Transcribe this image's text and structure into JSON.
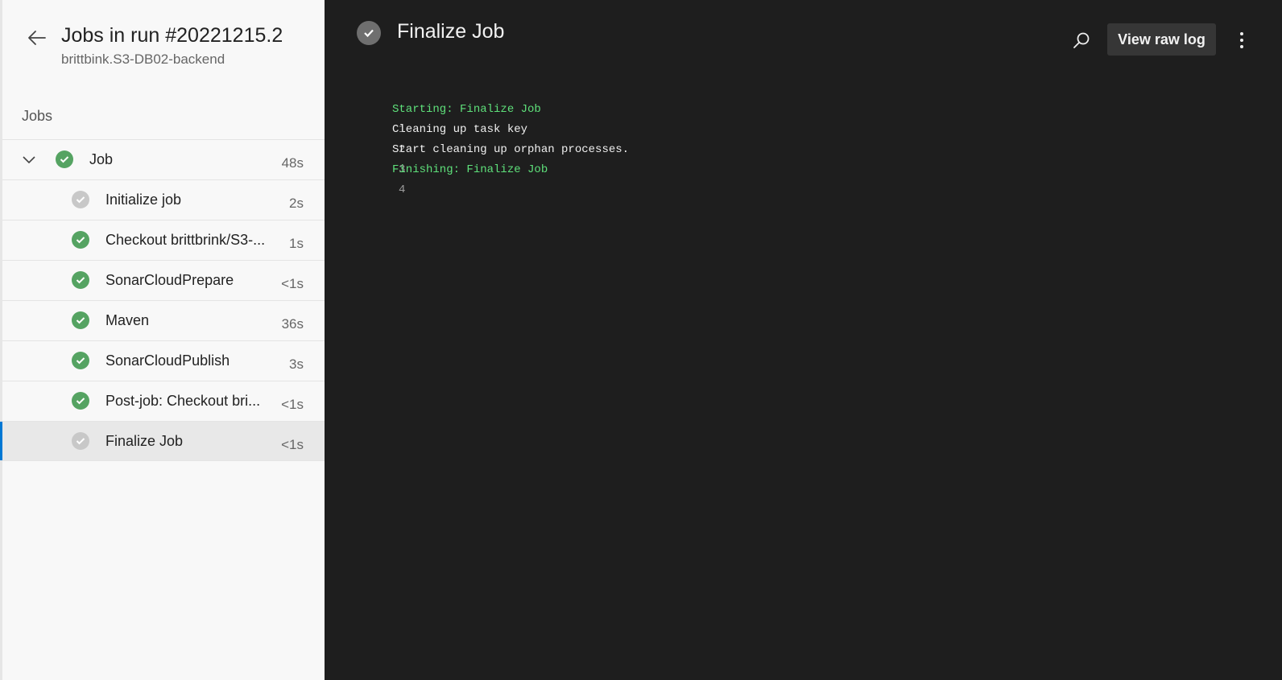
{
  "sidebar": {
    "title": "Jobs in run #20221215.2",
    "subtitle": "brittbink.S3-DB02-backend",
    "jobs_heading": "Jobs",
    "parent": {
      "label": "Job",
      "duration": "48s",
      "status": "succeeded"
    },
    "steps": [
      {
        "label": "Initialize job",
        "duration": "2s",
        "status": "skipped"
      },
      {
        "label": "Checkout brittbrink/S3-...",
        "duration": "1s",
        "status": "succeeded"
      },
      {
        "label": "SonarCloudPrepare",
        "duration": "<1s",
        "status": "succeeded"
      },
      {
        "label": "Maven",
        "duration": "36s",
        "status": "succeeded"
      },
      {
        "label": "SonarCloudPublish",
        "duration": "3s",
        "status": "succeeded"
      },
      {
        "label": "Post-job: Checkout bri...",
        "duration": "<1s",
        "status": "succeeded"
      },
      {
        "label": "Finalize Job",
        "duration": "<1s",
        "status": "skipped",
        "selected": true
      }
    ]
  },
  "main": {
    "title": "Finalize Job",
    "view_raw_label": "View raw log",
    "log": [
      {
        "num": "1",
        "text": "Starting: Finalize Job",
        "color": "#5ee07a"
      },
      {
        "num": "2",
        "text": "Cleaning up task key",
        "color": "#f0f0f0"
      },
      {
        "num": "3",
        "text": "Start cleaning up orphan processes.",
        "color": "#f0f0f0"
      },
      {
        "num": "4",
        "text": "Finishing: Finalize Job",
        "color": "#5ee07a"
      }
    ]
  },
  "colors": {
    "success": "#55a362",
    "skipped": "#c8c8c8",
    "accent": "#0078d4",
    "log_green": "#5ee07a"
  },
  "icons": {
    "back": "arrow-left-icon",
    "expand": "chevron-down-icon",
    "status_ok": "check-circle-icon",
    "search": "search-icon",
    "more": "more-vertical-icon"
  }
}
